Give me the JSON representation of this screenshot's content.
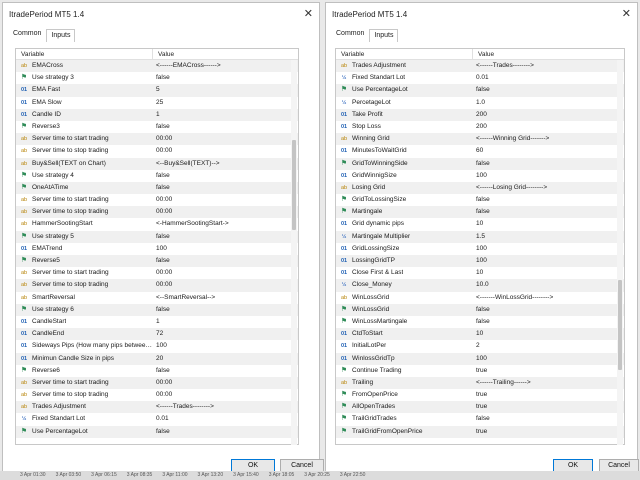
{
  "left": {
    "title": "ItradePeriod MT5 1.4",
    "tabs": [
      "Common",
      "Inputs"
    ],
    "headers": {
      "variable": "Variable",
      "value": "Value"
    },
    "ok": "OK",
    "cancel": "Cancel",
    "rows": [
      {
        "icon": "ab",
        "name": "EMACross",
        "value": "<------EMACross------>"
      },
      {
        "icon": "flag",
        "name": "Use strategy 3",
        "value": "false"
      },
      {
        "icon": "01",
        "name": "EMA Fast",
        "value": "5"
      },
      {
        "icon": "01",
        "name": "EMA Slow",
        "value": "25"
      },
      {
        "icon": "01",
        "name": "Candle ID",
        "value": "1"
      },
      {
        "icon": "flag",
        "name": "Reverse3",
        "value": "false"
      },
      {
        "icon": "ab",
        "name": "Server time to start trading",
        "value": "00:00"
      },
      {
        "icon": "ab",
        "name": "Server time to stop trading",
        "value": "00:00"
      },
      {
        "icon": "ab",
        "name": "Buy&Sell(TEXT on Chart)",
        "value": "<--Buy&Sell(TEXT)-->"
      },
      {
        "icon": "flag",
        "name": "Use strategy 4",
        "value": "false"
      },
      {
        "icon": "flag",
        "name": "OneAtATime",
        "value": "false"
      },
      {
        "icon": "ab",
        "name": "Server time to start trading",
        "value": "00:00"
      },
      {
        "icon": "ab",
        "name": "Server time to stop trading",
        "value": "00:00"
      },
      {
        "icon": "ab",
        "name": "HammerSootingStart",
        "value": "<-HammerSootingStart->"
      },
      {
        "icon": "flag",
        "name": "Use strategy 5",
        "value": "false"
      },
      {
        "icon": "01",
        "name": "EMATrend",
        "value": "100"
      },
      {
        "icon": "flag",
        "name": "Reverse5",
        "value": "false"
      },
      {
        "icon": "ab",
        "name": "Server time to start trading",
        "value": "00:00"
      },
      {
        "icon": "ab",
        "name": "Server time to stop trading",
        "value": "00:00"
      },
      {
        "icon": "ab",
        "name": "SmartReversal",
        "value": "<--SmartReversal-->"
      },
      {
        "icon": "flag",
        "name": "Use strategy 6",
        "value": "false"
      },
      {
        "icon": "01",
        "name": "CandleStart",
        "value": "1"
      },
      {
        "icon": "01",
        "name": "CandleEnd",
        "value": "72"
      },
      {
        "icon": "01",
        "name": "Sideways Pips (How many pips between...",
        "value": "100"
      },
      {
        "icon": "01",
        "name": "Minimun Candle Size in pips",
        "value": "20"
      },
      {
        "icon": "flag",
        "name": "Reverse6",
        "value": "false"
      },
      {
        "icon": "ab",
        "name": "Server time to start trading",
        "value": "00:00"
      },
      {
        "icon": "ab",
        "name": "Server time to stop trading",
        "value": "00:00"
      },
      {
        "icon": "ab",
        "name": "Trades Adjustment",
        "value": "<------Trades-------->"
      },
      {
        "icon": "12",
        "name": "Fixed Standart Lot",
        "value": "0.01"
      },
      {
        "icon": "flag",
        "name": "Use PercentageLot",
        "value": "false"
      }
    ]
  },
  "right": {
    "title": "ItradePeriod MT5 1.4",
    "tabs": [
      "Common",
      "Inputs"
    ],
    "headers": {
      "variable": "Variable",
      "value": "Value"
    },
    "ok": "OK",
    "cancel": "Cancel",
    "rows": [
      {
        "icon": "ab",
        "name": "Trades Adjustment",
        "value": "<------Trades-------->"
      },
      {
        "icon": "12",
        "name": "Fixed Standart Lot",
        "value": "0.01"
      },
      {
        "icon": "flag",
        "name": "Use PercentageLot",
        "value": "false"
      },
      {
        "icon": "12",
        "name": "PercetageLot",
        "value": "1.0"
      },
      {
        "icon": "01",
        "name": "Take Profit",
        "value": "200"
      },
      {
        "icon": "01",
        "name": "Stop Loss",
        "value": "200"
      },
      {
        "icon": "ab",
        "name": "Winning Grid",
        "value": "<------Winning Grid------->"
      },
      {
        "icon": "01",
        "name": "MinutesToWaitGrid",
        "value": "60"
      },
      {
        "icon": "flag",
        "name": "GridToWinningSide",
        "value": "false"
      },
      {
        "icon": "01",
        "name": "GridWinnigSize",
        "value": "100"
      },
      {
        "icon": "ab",
        "name": "Losing Grid",
        "value": "<------Losing Grid-------->"
      },
      {
        "icon": "flag",
        "name": "GridToLossingSize",
        "value": "false"
      },
      {
        "icon": "flag",
        "name": "Martingale",
        "value": "false"
      },
      {
        "icon": "01",
        "name": "Grid dynamic pips",
        "value": "10"
      },
      {
        "icon": "12",
        "name": "Martingale Multiplier",
        "value": "1.5"
      },
      {
        "icon": "01",
        "name": "GridLossingSize",
        "value": "100"
      },
      {
        "icon": "01",
        "name": "LossingGridTP",
        "value": "100"
      },
      {
        "icon": "01",
        "name": "Close First & Last",
        "value": "10"
      },
      {
        "icon": "12",
        "name": "Close_Money",
        "value": "10.0"
      },
      {
        "icon": "ab",
        "name": "WinLossGrid",
        "value": "<-------WinLossGrid-------->"
      },
      {
        "icon": "flag",
        "name": "WinLossGrid",
        "value": "false"
      },
      {
        "icon": "flag",
        "name": "WinLossMartingale",
        "value": "false"
      },
      {
        "icon": "01",
        "name": "CtdToStart",
        "value": "10"
      },
      {
        "icon": "01",
        "name": "InitialLotPer",
        "value": "2"
      },
      {
        "icon": "01",
        "name": "WinlossGridTp",
        "value": "100"
      },
      {
        "icon": "flag",
        "name": "Continue Trading",
        "value": "true"
      },
      {
        "icon": "ab",
        "name": "Trailing",
        "value": "<------Trailing------>"
      },
      {
        "icon": "flag",
        "name": "FromOpenPrice",
        "value": "true"
      },
      {
        "icon": "flag",
        "name": "AllOpenTrades",
        "value": "true"
      },
      {
        "icon": "flag",
        "name": "TrailGridTrades",
        "value": "false"
      },
      {
        "icon": "flag",
        "name": "TrailGridFromOpenPrice",
        "value": "true"
      }
    ]
  },
  "taskbar_times": [
    "3 Apr 01:30",
    "3 Apr 03:50",
    "3 Apr 06:15",
    "3 Apr 08:35",
    "3 Apr 11:00",
    "3 Apr 13:20",
    "3 Apr 15:40",
    "3 Apr 18:05",
    "3 Apr 20:25",
    "3 Apr 22:50"
  ],
  "icons": {
    "ab": "ab",
    "01": "01",
    "12": "½",
    "flag": "⚑"
  }
}
